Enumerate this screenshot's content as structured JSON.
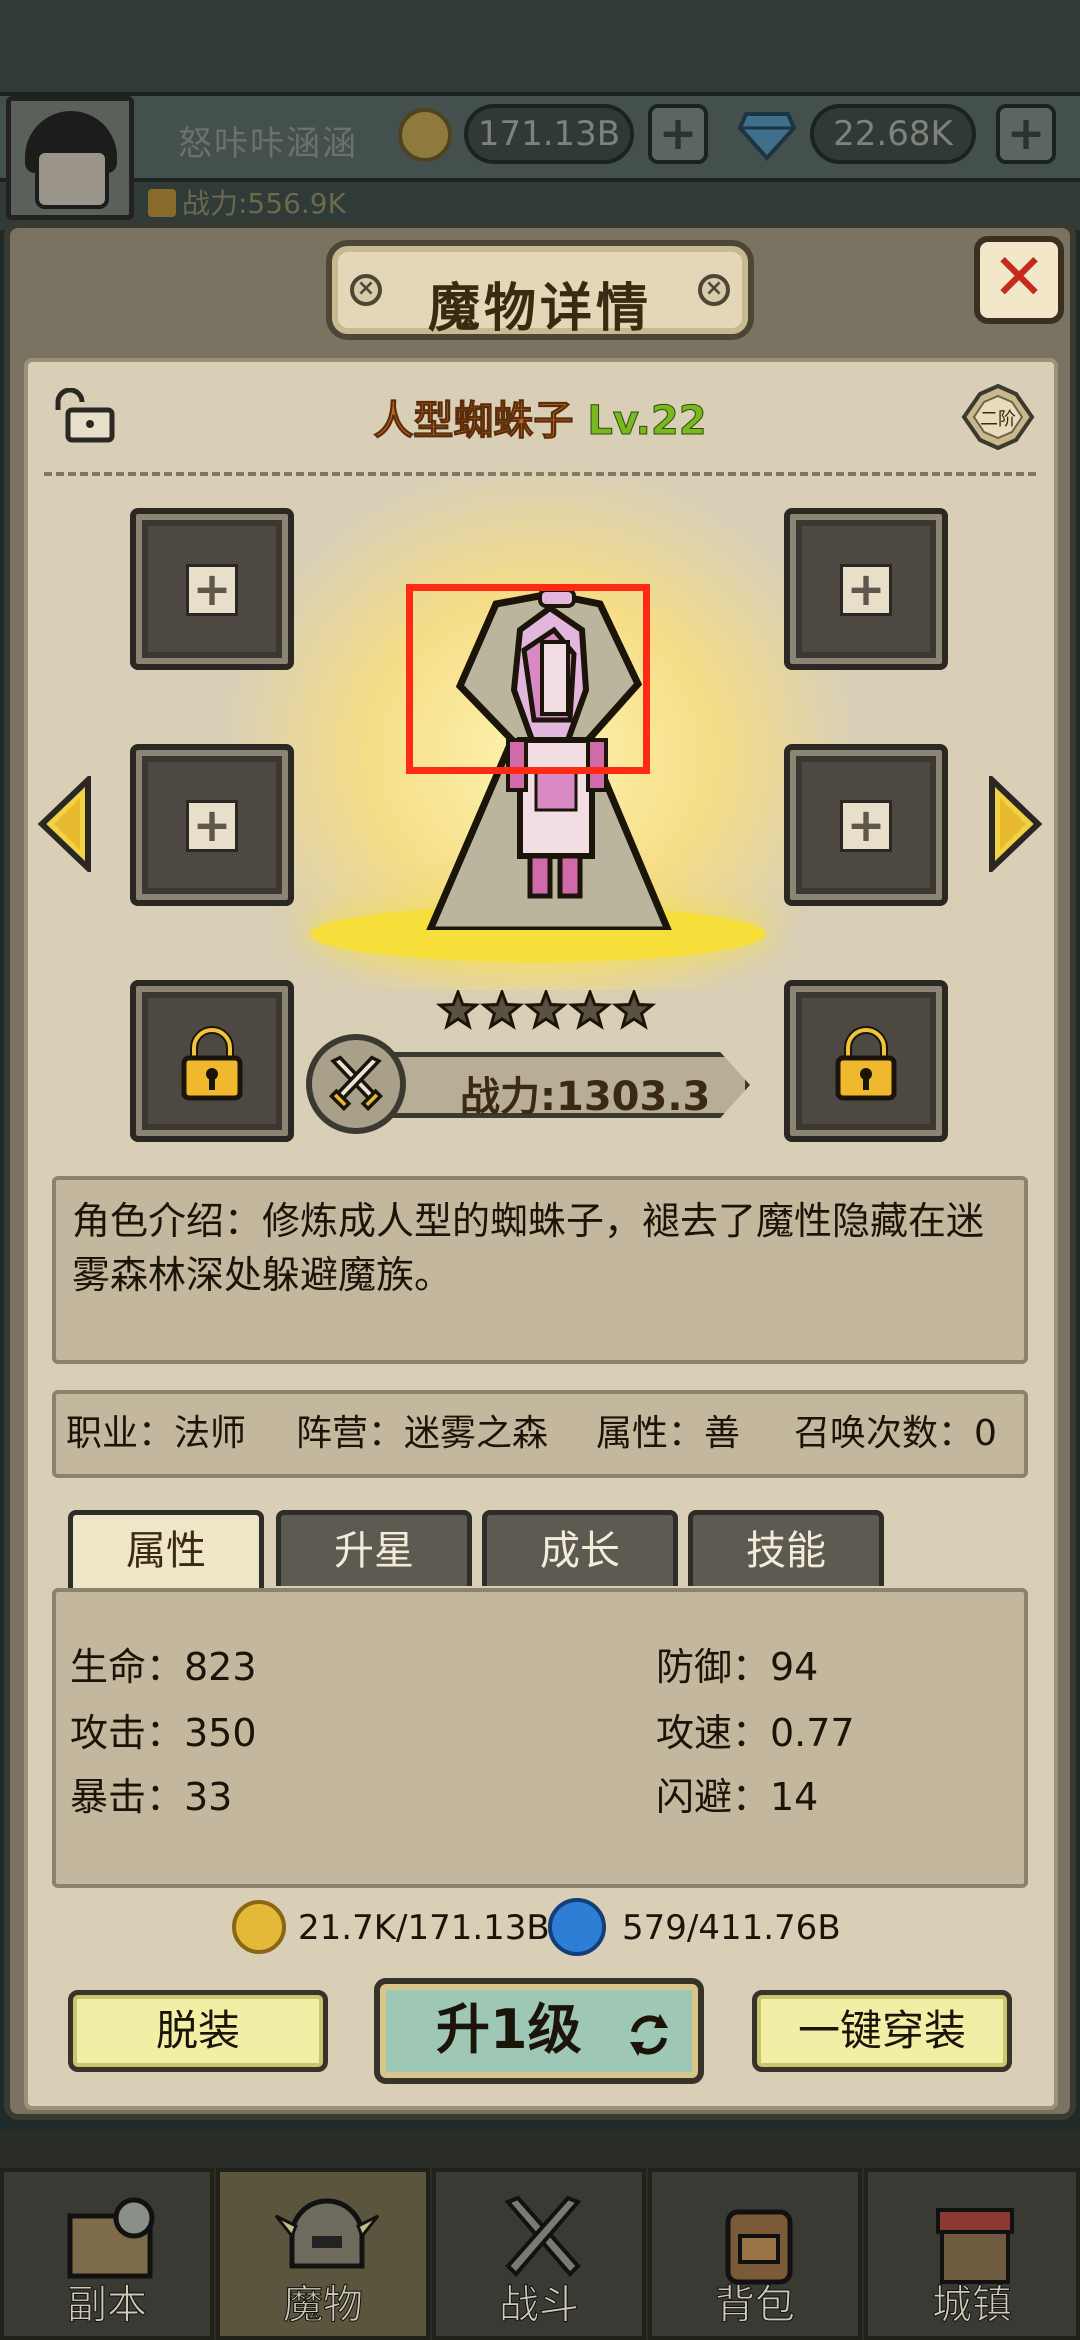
{
  "hud": {
    "player_name": "怒咔咔涵涵",
    "player_power": "战力:556.9K",
    "gold": "171.13B",
    "diamond": "22.68K",
    "plus": "+"
  },
  "modal": {
    "title": "魔物详情",
    "close": "✕",
    "monster_name": "人型蜘蛛子",
    "monster_level": "Lv.22",
    "rank": "二阶",
    "power": "战力:1303.3",
    "stars": 5,
    "description": "角色介绍：修炼成人型的蜘蛛子，褪去了魔性隐藏在迷雾森林深处躲避魔族。",
    "info": {
      "job": "职业：法师",
      "camp": "阵营：迷雾之森",
      "nature": "属性：善",
      "summons": "召唤次数：0"
    },
    "tabs": [
      "属性",
      "升星",
      "成长",
      "技能"
    ],
    "attributes": {
      "hp": "生命：823",
      "defense": "防御：94",
      "attack": "攻击：350",
      "attack_speed": "攻速：0.77",
      "crit": "暴击：33",
      "dodge": "闪避：14"
    },
    "cost_gold": "21.7K/171.13B",
    "cost_gem": "579/411.76B",
    "buttons": {
      "unequip": "脱装",
      "level_up": "升1级",
      "equip_all": "一键穿装"
    }
  },
  "bottom_nav": [
    "副本",
    "魔物",
    "战斗",
    "背包",
    "城镇"
  ],
  "colors": {
    "panel": "#d9cfb6",
    "accent_name": "#c26a1e",
    "level": "#79b91f",
    "highlight_box": "#ff2a14"
  }
}
